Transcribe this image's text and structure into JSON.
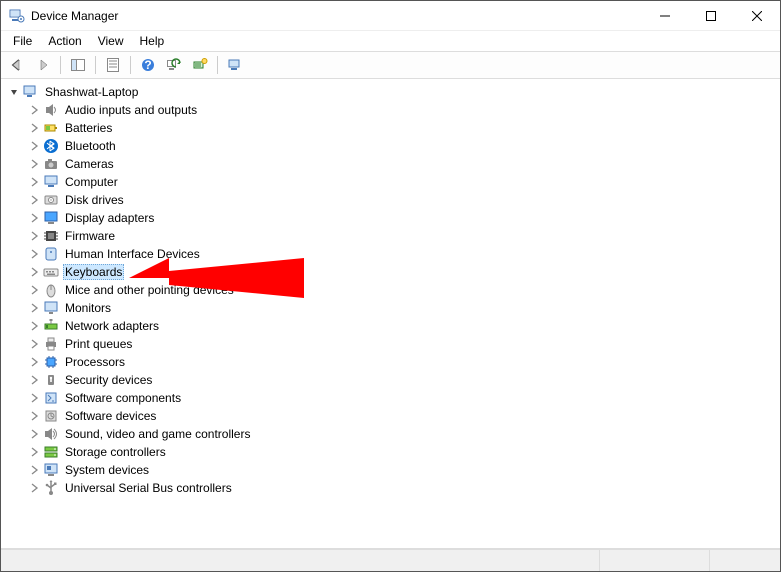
{
  "window": {
    "title": "Device Manager"
  },
  "menu": {
    "items": [
      "File",
      "Action",
      "View",
      "Help"
    ]
  },
  "tree": {
    "root": {
      "label": "Shashwat-Laptop",
      "expanded": true
    },
    "categories": [
      {
        "label": "Audio inputs and outputs",
        "icon": "speaker"
      },
      {
        "label": "Batteries",
        "icon": "battery"
      },
      {
        "label": "Bluetooth",
        "icon": "bluetooth"
      },
      {
        "label": "Cameras",
        "icon": "camera"
      },
      {
        "label": "Computer",
        "icon": "computer"
      },
      {
        "label": "Disk drives",
        "icon": "disk"
      },
      {
        "label": "Display adapters",
        "icon": "display"
      },
      {
        "label": "Firmware",
        "icon": "firmware"
      },
      {
        "label": "Human Interface Devices",
        "icon": "hid"
      },
      {
        "label": "Keyboards",
        "icon": "keyboard",
        "selected": true
      },
      {
        "label": "Mice and other pointing devices",
        "icon": "mouse"
      },
      {
        "label": "Monitors",
        "icon": "monitor"
      },
      {
        "label": "Network adapters",
        "icon": "network"
      },
      {
        "label": "Print queues",
        "icon": "printer"
      },
      {
        "label": "Processors",
        "icon": "cpu"
      },
      {
        "label": "Security devices",
        "icon": "security"
      },
      {
        "label": "Software components",
        "icon": "swcomp"
      },
      {
        "label": "Software devices",
        "icon": "swdev"
      },
      {
        "label": "Sound, video and game controllers",
        "icon": "sound"
      },
      {
        "label": "Storage controllers",
        "icon": "storage"
      },
      {
        "label": "System devices",
        "icon": "system"
      },
      {
        "label": "Universal Serial Bus controllers",
        "icon": "usb"
      }
    ]
  }
}
